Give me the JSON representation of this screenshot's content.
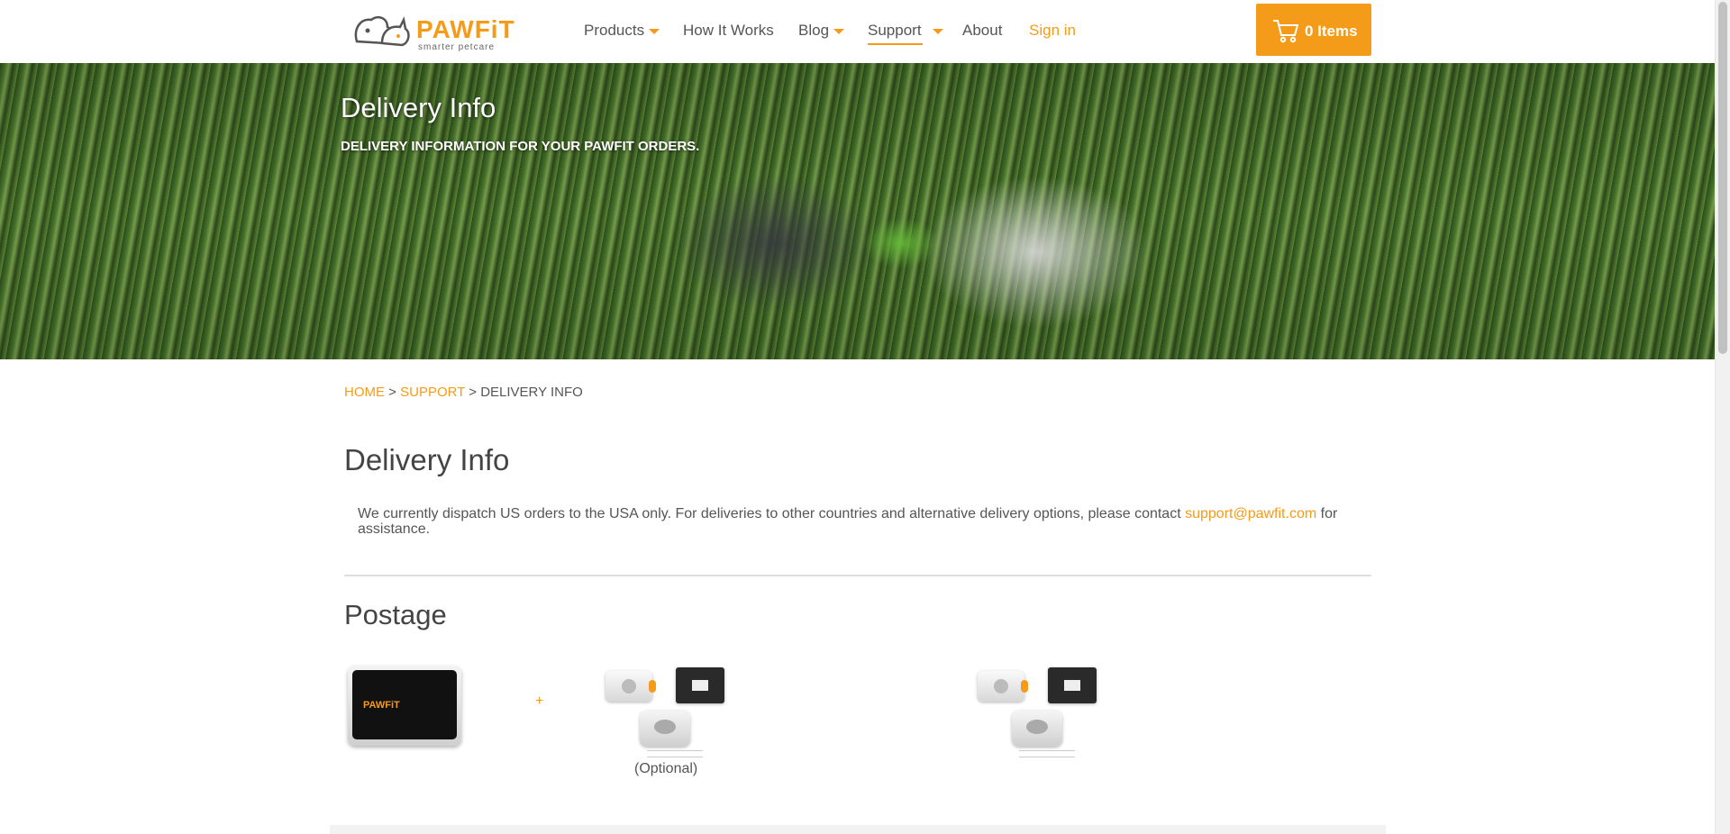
{
  "brand": {
    "name": "PAWFiT",
    "tagline": "smarter petcare",
    "accent": "#f59b1a"
  },
  "nav": {
    "products": "Products",
    "how_it_works": "How It Works",
    "blog": "Blog",
    "support": "Support",
    "about": "About",
    "sign_in": "Sign in",
    "active": "Support"
  },
  "cart": {
    "count_label": "0  Items",
    "icon": "cart-icon"
  },
  "hero": {
    "title": "Delivery Info",
    "subtitle": "DELIVERY INFORMATION FOR YOUR PAWFIT ORDERS."
  },
  "breadcrumb": {
    "home": "HOME",
    "sep1": " > ",
    "support": "SUPPORT",
    "sep2": " > ",
    "current": "DELIVERY INFO"
  },
  "main": {
    "title": "Delivery Info",
    "intro_before": "We currently dispatch US orders to the USA only. For deliveries to other countries and alternative delivery options, please contact ",
    "intro_email": "support@pawfit.com",
    "intro_after": " for assistance.",
    "postage_heading": "Postage",
    "plus": "+",
    "optional": "(Optional)",
    "tracker_screen_text": "PAWFiT"
  }
}
